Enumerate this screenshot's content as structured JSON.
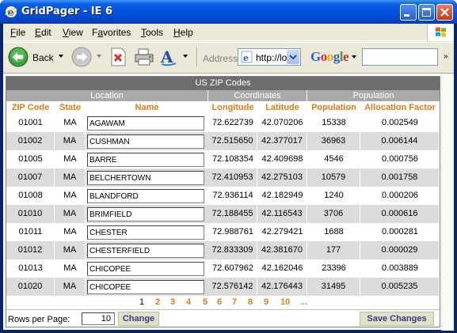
{
  "window": {
    "title": "GridPager - IE 6"
  },
  "menu": [
    "File",
    "Edit",
    "View",
    "Favorites",
    "Tools",
    "Help"
  ],
  "menu_access": [
    "F",
    "E",
    "V",
    "a",
    "T",
    "H"
  ],
  "toolbar": {
    "back_label": "Back",
    "address_label": "Address",
    "address_value": "http://lo",
    "search_brand": "Google",
    "search_value": ""
  },
  "grid": {
    "caption": "US ZIP Codes",
    "groups": {
      "location": "Location",
      "coordinates": "Coordinates",
      "population": "Population"
    },
    "columns": [
      "ZIP Code",
      "State",
      "Name",
      "Longitude",
      "Latitude",
      "Population",
      "Allocation Factor"
    ],
    "rows": [
      {
        "zip": "01001",
        "state": "MA",
        "name": "AGAWAM",
        "lon": "72.622739",
        "lat": "42.070206",
        "pop": "15338",
        "alloc": "0.002549"
      },
      {
        "zip": "01002",
        "state": "MA",
        "name": "CUSHMAN",
        "lon": "72.515650",
        "lat": "42.377017",
        "pop": "36963",
        "alloc": "0.006144"
      },
      {
        "zip": "01005",
        "state": "MA",
        "name": "BARRE",
        "lon": "72.108354",
        "lat": "42.409698",
        "pop": "4546",
        "alloc": "0.000756"
      },
      {
        "zip": "01007",
        "state": "MA",
        "name": "BELCHERTOWN",
        "lon": "72.410953",
        "lat": "42.275103",
        "pop": "10579",
        "alloc": "0.001758"
      },
      {
        "zip": "01008",
        "state": "MA",
        "name": "BLANDFORD",
        "lon": "72.936114",
        "lat": "42.182949",
        "pop": "1240",
        "alloc": "0.000206"
      },
      {
        "zip": "01010",
        "state": "MA",
        "name": "BRIMFIELD",
        "lon": "72.188455",
        "lat": "42.116543",
        "pop": "3706",
        "alloc": "0.000616"
      },
      {
        "zip": "01011",
        "state": "MA",
        "name": "CHESTER",
        "lon": "72.988761",
        "lat": "42.279421",
        "pop": "1688",
        "alloc": "0.000281"
      },
      {
        "zip": "01012",
        "state": "MA",
        "name": "CHESTERFIELD",
        "lon": "72.833309",
        "lat": "42.381670",
        "pop": "177",
        "alloc": "0.000029"
      },
      {
        "zip": "01013",
        "state": "MA",
        "name": "CHICOPEE",
        "lon": "72.607962",
        "lat": "42.162046",
        "pop": "23396",
        "alloc": "0.003889"
      },
      {
        "zip": "01020",
        "state": "MA",
        "name": "CHICOPEE",
        "lon": "72.576142",
        "lat": "42.176443",
        "pop": "31495",
        "alloc": "0.005235"
      }
    ],
    "pages": [
      "1",
      "2",
      "3",
      "4",
      "5",
      "6",
      "7",
      "8",
      "9",
      "10",
      "..."
    ],
    "current_page": "1",
    "rows_per_page_label": "Rows per Page:",
    "rows_per_page_value": "10",
    "change_label": "Change",
    "save_label": "Save Changes"
  },
  "colors": {
    "header_text": "#e07a12",
    "caption_bg": "#6d6d6d",
    "group_bg": "#a9a9a9",
    "alt_row_bg": "#dcdcdc",
    "titlebar": "#0054e3"
  },
  "icons": [
    "ie-app-icon",
    "minimize-icon",
    "maximize-icon",
    "close-icon",
    "windows-logo-icon",
    "back-arrow-icon",
    "forward-arrow-icon",
    "stop-icon",
    "print-icon",
    "font-size-icon",
    "ie-page-icon",
    "chevron-down-icon"
  ]
}
